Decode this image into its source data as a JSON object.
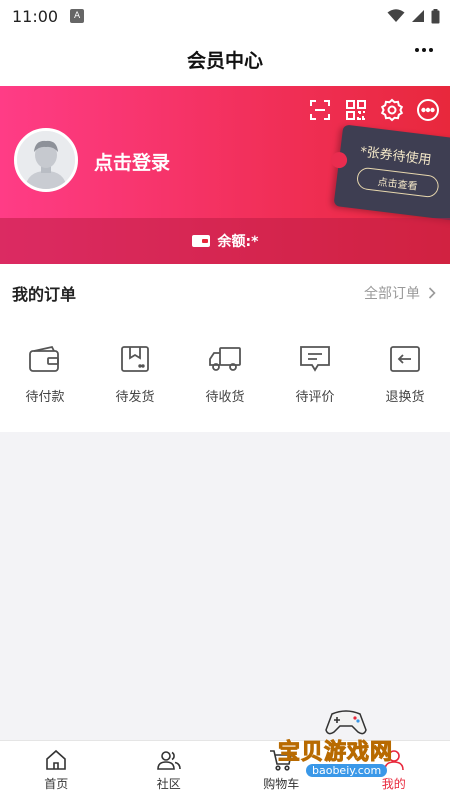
{
  "status_bar": {
    "time": "11:00",
    "app_icon_letter": "A"
  },
  "header": {
    "title": "会员中心"
  },
  "banner": {
    "login_label": "点击登录",
    "ticket_text": "*张券待使用",
    "ticket_button": "点击查看",
    "balance_label": "余额:*",
    "tools": [
      "scan-icon",
      "qr-code-icon",
      "settings-icon",
      "message-icon"
    ]
  },
  "orders": {
    "title": "我的订单",
    "all_label": "全部订单",
    "items": [
      {
        "icon": "wallet-icon",
        "label": "待付款"
      },
      {
        "icon": "package-icon",
        "label": "待发货"
      },
      {
        "icon": "truck-icon",
        "label": "待收货"
      },
      {
        "icon": "comment-icon",
        "label": "待评价"
      },
      {
        "icon": "return-icon",
        "label": "退换货"
      }
    ]
  },
  "bottom_nav": {
    "items": [
      {
        "icon": "home-icon",
        "label": "首页"
      },
      {
        "icon": "community-icon",
        "label": "社区"
      },
      {
        "icon": "cart-icon",
        "label": "购物车"
      },
      {
        "icon": "profile-icon",
        "label": "我的"
      }
    ],
    "active_index": 3
  },
  "watermark": {
    "text": "宝贝游戏网",
    "url": "baobeiy.com"
  },
  "colors": {
    "accent": "#e8283c",
    "banner_start": "#ff3c86",
    "banner_end": "#e8283c"
  }
}
